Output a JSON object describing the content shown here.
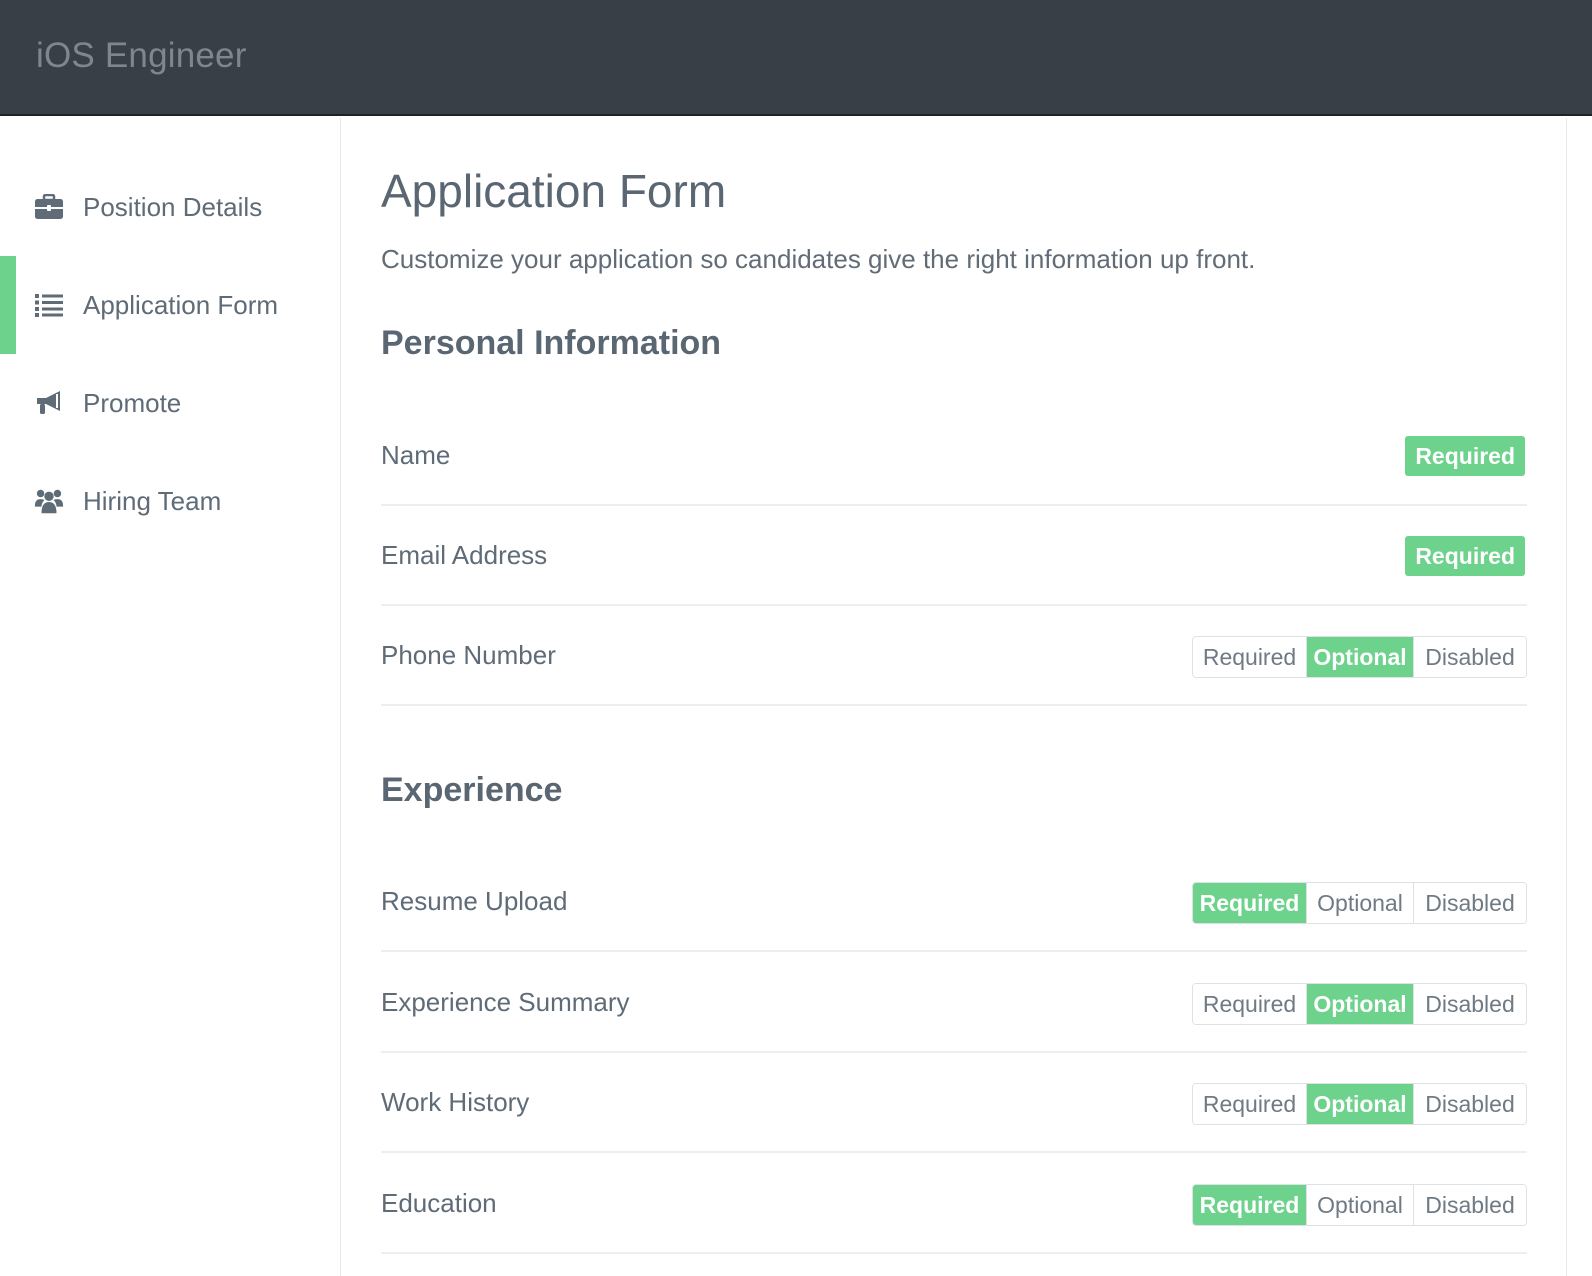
{
  "header": {
    "title": "iOS Engineer"
  },
  "sidebar": {
    "items": [
      {
        "label": "Position Details",
        "icon": "briefcase-icon"
      },
      {
        "label": "Application Form",
        "icon": "list-icon",
        "active": true
      },
      {
        "label": "Promote",
        "icon": "megaphone-icon"
      },
      {
        "label": "Hiring Team",
        "icon": "users-icon"
      }
    ]
  },
  "main": {
    "title": "Application Form",
    "subtitle": "Customize your application so candidates give the right information up front.",
    "sections": [
      {
        "title": "Personal Information",
        "fields": [
          {
            "label": "Name",
            "badge": "Required"
          },
          {
            "label": "Email Address",
            "badge": "Required"
          },
          {
            "label": "Phone Number",
            "selected": "Optional"
          }
        ]
      },
      {
        "title": "Experience",
        "fields": [
          {
            "label": "Resume Upload",
            "selected": "Required"
          },
          {
            "label": "Experience Summary",
            "selected": "Optional"
          },
          {
            "label": "Work History",
            "selected": "Optional"
          },
          {
            "label": "Education",
            "selected": "Required"
          }
        ]
      }
    ],
    "options": [
      "Required",
      "Optional",
      "Disabled"
    ]
  },
  "colors": {
    "header_bg": "#393f47",
    "accent": "#6dd38c",
    "text": "#5f6b77"
  }
}
